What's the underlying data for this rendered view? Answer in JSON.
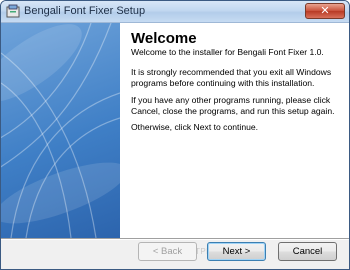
{
  "window": {
    "title": "Bengali Font Fixer Setup",
    "close_glyph": "✕",
    "app_icon": "setup-icon"
  },
  "content": {
    "heading": "Welcome",
    "paragraphs": [
      "Welcome to the installer for Bengali Font Fixer 1.0.",
      "It is strongly recommended that you exit all Windows programs before continuing with this installation.",
      "If you have any other programs running, please click Cancel, close the programs, and run this setup again.",
      "Otherwise, click Next to continue."
    ]
  },
  "buttons": {
    "back": "< Back",
    "next": "Next >",
    "cancel": "Cancel"
  },
  "watermark": "SOFTPEDIA",
  "colors": {
    "sidebar_blue": "#3f7fc6",
    "title_gradient": "#c2d8f0",
    "close_red": "#c9503a"
  }
}
